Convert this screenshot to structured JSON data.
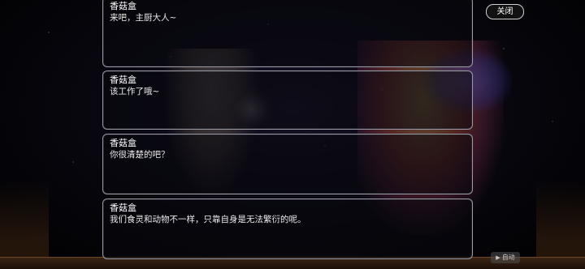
{
  "toolbar": {
    "close_label": "关闭",
    "auto_label": "自动",
    "auto_icon": "play-icon"
  },
  "dialog_log": [
    {
      "speaker": "香菇盒",
      "text": "来吧，主厨大人~"
    },
    {
      "speaker": "香菇盒",
      "text": "该工作了哦~"
    },
    {
      "speaker": "香菇盒",
      "text": "你很清楚的吧？"
    },
    {
      "speaker": "香菇盒",
      "text": "我们食灵和动物不一样，只靠自身是无法繁衍的呢。"
    }
  ],
  "colors": {
    "card_border": "#9a9aa4",
    "background": "#000000",
    "text": "#ffffff"
  }
}
